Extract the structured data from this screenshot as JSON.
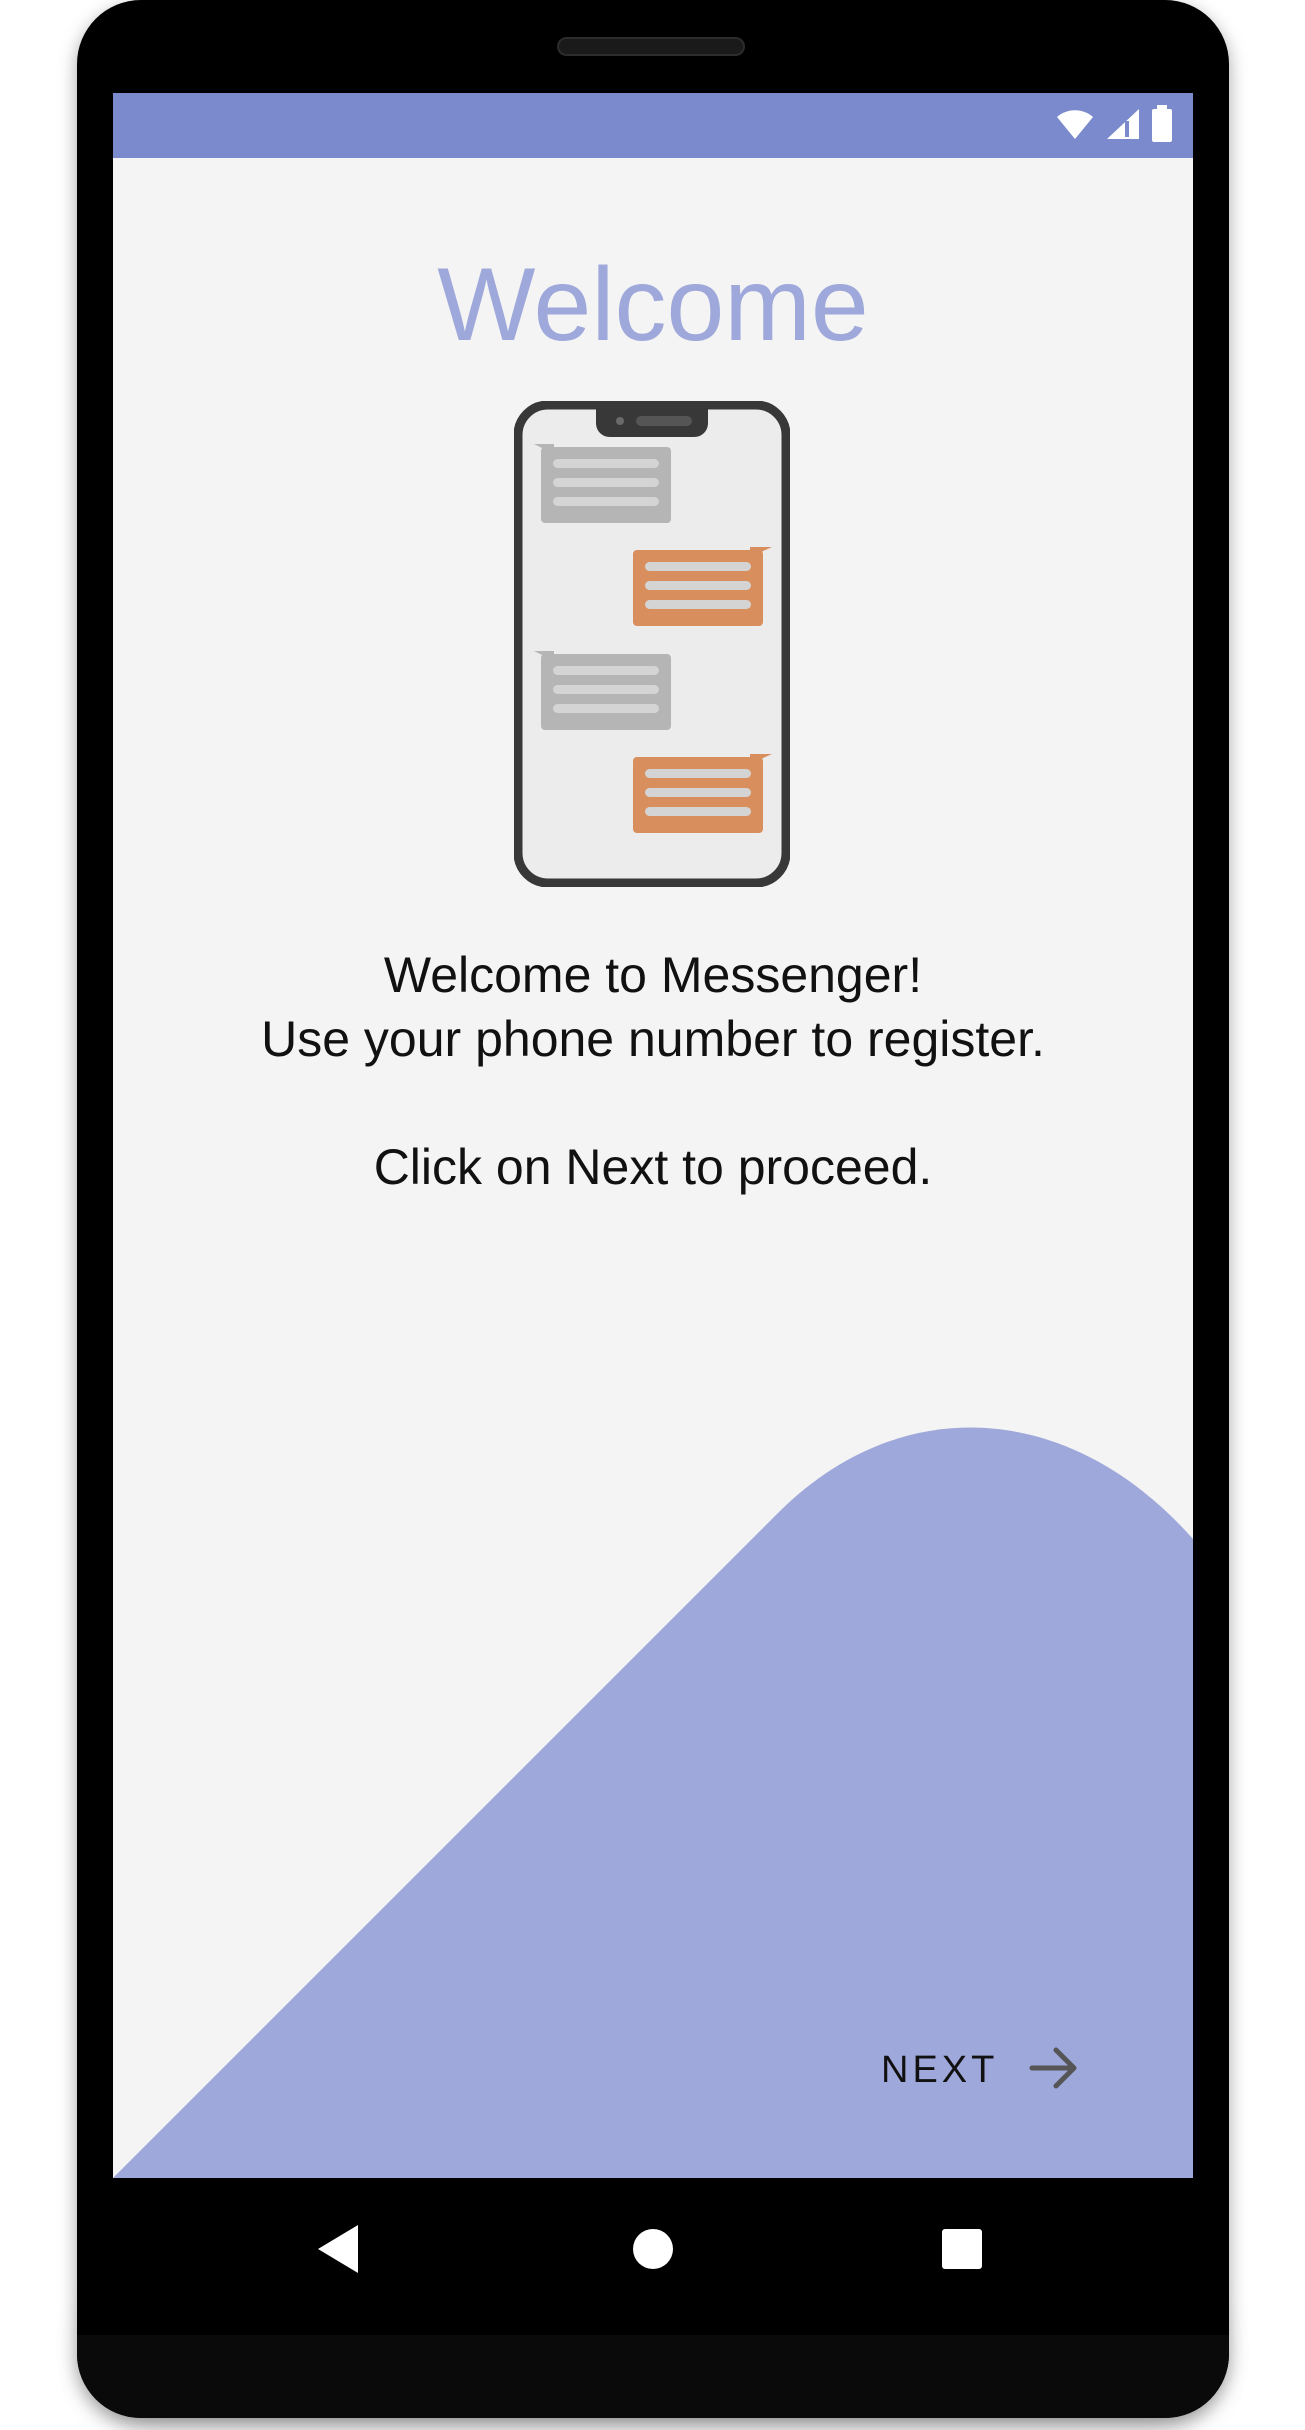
{
  "header": {
    "title": "Welcome"
  },
  "content": {
    "line1": "Welcome to Messenger!",
    "line2": "Use your phone number to register.",
    "line3": "Click on Next to proceed."
  },
  "actions": {
    "next_label": "NEXT",
    "next_icon": "arrow-right-icon"
  },
  "status_bar": {
    "icons": [
      "wifi-icon",
      "cell-signal-icon",
      "battery-icon"
    ]
  },
  "nav_bar": {
    "icons": [
      "back-icon",
      "home-icon",
      "recents-icon"
    ]
  },
  "colors": {
    "status_bar": "#7a8acc",
    "title": "#9fa8da",
    "wave": "#9fa8da",
    "background": "#f4f4f4",
    "bubble_incoming": "#b5b5b5",
    "bubble_outgoing": "#d98f5d"
  }
}
